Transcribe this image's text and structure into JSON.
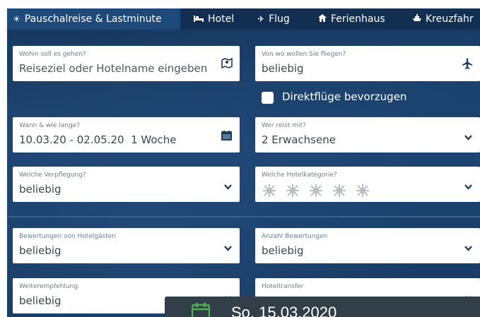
{
  "tabs": [
    {
      "label": "Pauschalreise & Lastminute",
      "icon": "sun-icon",
      "active": true
    },
    {
      "label": "Hotel",
      "icon": "bed-icon",
      "active": false
    },
    {
      "label": "Flug",
      "icon": "plane-icon",
      "active": false
    },
    {
      "label": "Ferienhaus",
      "icon": "house-icon",
      "active": false
    },
    {
      "label": "Kreuzfahr",
      "icon": "ship-icon",
      "active": false
    }
  ],
  "fields": {
    "destination": {
      "label": "Wohin soll es gehen?",
      "placeholder": "Reiseziel oder Hotelname eingeben",
      "icon": "map-icon"
    },
    "departure": {
      "label": "Von wo wollen Sie fliegen?",
      "value": "beliebig",
      "icon": "plane-icon"
    },
    "direct_flights": {
      "label": "Direktflüge bevorzugen",
      "checked": false
    },
    "dates": {
      "label": "Wann & wie lange?",
      "value": "10.03.20 - 02.05.20  1 Woche",
      "icon": "calendar-icon"
    },
    "travelers": {
      "label": "Wer reist mit?",
      "value": "2 Erwachsene"
    },
    "board": {
      "label": "Welche Verpflegung?",
      "value": "beliebig"
    },
    "hotel_category": {
      "label": "Welche Hotelkategorie?",
      "stars": 5,
      "selected": 0
    },
    "guest_rating": {
      "label": "Bewertungen von Hotelgästen",
      "value": "beliebig"
    },
    "review_count": {
      "label": "Anzahl Bewertungen",
      "value": "beliebig"
    },
    "recommendation": {
      "label": "Weiterempfehlung",
      "value": "beliebig"
    },
    "transfer": {
      "label": "Hoteltransfer"
    }
  },
  "popup": {
    "date": "So. 15.03.2020",
    "icon": "calendar-icon"
  },
  "colors": {
    "panel": "#1c4470",
    "tabbar": "#122f52",
    "active_tab": "#1d4a7a",
    "popup": "#323f48",
    "popup_icon": "#4caf50",
    "icon": "#1b3d63"
  }
}
